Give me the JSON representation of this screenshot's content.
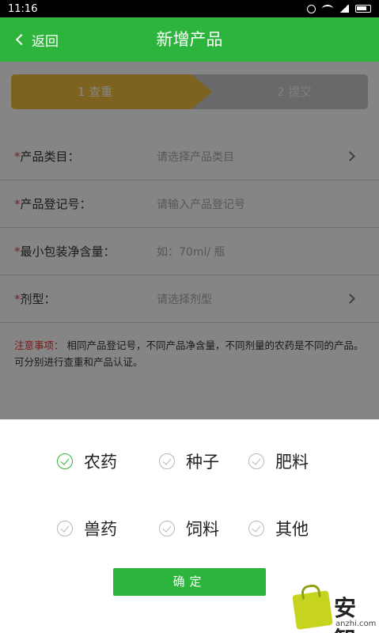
{
  "status_bar": {
    "time": "11:16"
  },
  "app_bar": {
    "back_label": "返回",
    "title": "新增产品"
  },
  "steps": [
    {
      "label": "1  查重"
    },
    {
      "label": "2  提交"
    }
  ],
  "form": {
    "required_mark": "*",
    "rows": [
      {
        "label": "产品类目：",
        "placeholder": "请选择产品类目"
      },
      {
        "label": "产品登记号：",
        "placeholder": "请输入产品登记号"
      },
      {
        "label": "最小包装净含量：",
        "placeholder": "如：70ml/ 瓶"
      },
      {
        "label": "剂型：",
        "placeholder": "请选择剂型"
      }
    ]
  },
  "note": {
    "label": "注意事项：",
    "text": "  相同产品登记号，不同产品净含量，不同剂量的农药是不同的产品。可分别进行查重和产品认证。"
  },
  "picker": {
    "options": [
      {
        "label": "农药",
        "selected": true
      },
      {
        "label": "种子",
        "selected": false
      },
      {
        "label": "肥料",
        "selected": false
      },
      {
        "label": "兽药",
        "selected": false
      },
      {
        "label": "饲料",
        "selected": false
      },
      {
        "label": "其他",
        "selected": false
      }
    ],
    "confirm_label": "确定"
  },
  "watermark": {
    "brand": "安智",
    "domain": "anzhi.com"
  },
  "colors": {
    "accent": "#2db43c",
    "step_active": "#f2bd3f",
    "required": "#e44444"
  }
}
